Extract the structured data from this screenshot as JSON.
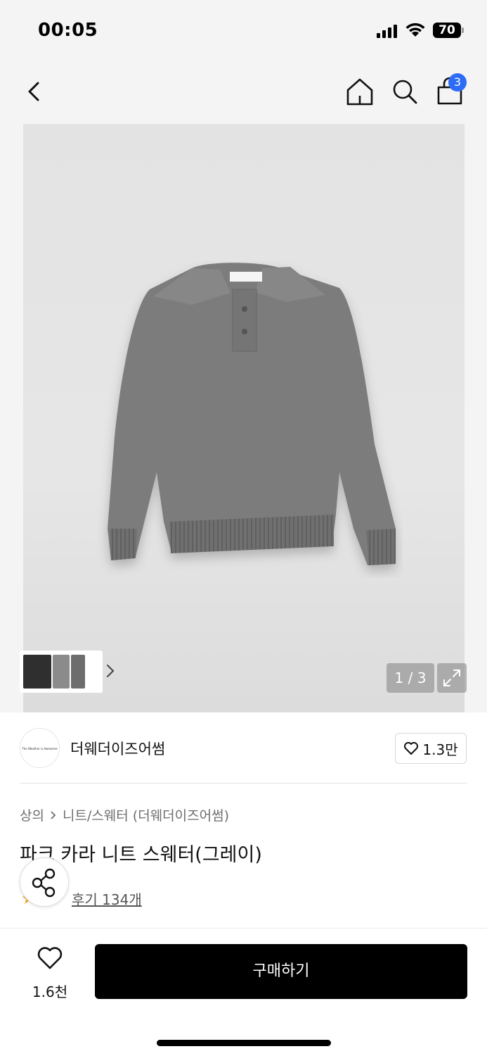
{
  "status_bar": {
    "time": "00:05",
    "battery": "70"
  },
  "nav": {
    "cart_count": "3"
  },
  "gallery": {
    "page_counter": "1 / 3"
  },
  "brand": {
    "name": "더웨더이즈어썸",
    "logo_text": "The Weather is Awesome",
    "likes": "1.3만"
  },
  "breadcrumb": {
    "category": "상의",
    "subcategory": "니트/스웨터 (더웨더이즈어썸)"
  },
  "product": {
    "title": "파크 카라 니트 스웨터(그레이)",
    "reviews": "후기 134개"
  },
  "bottom": {
    "wish_count": "1.6천",
    "buy_label": "구매하기"
  },
  "colors": {
    "accent_badge": "#2d6cf6",
    "buy_button": "#000000",
    "rating_star": "#f5a623"
  }
}
